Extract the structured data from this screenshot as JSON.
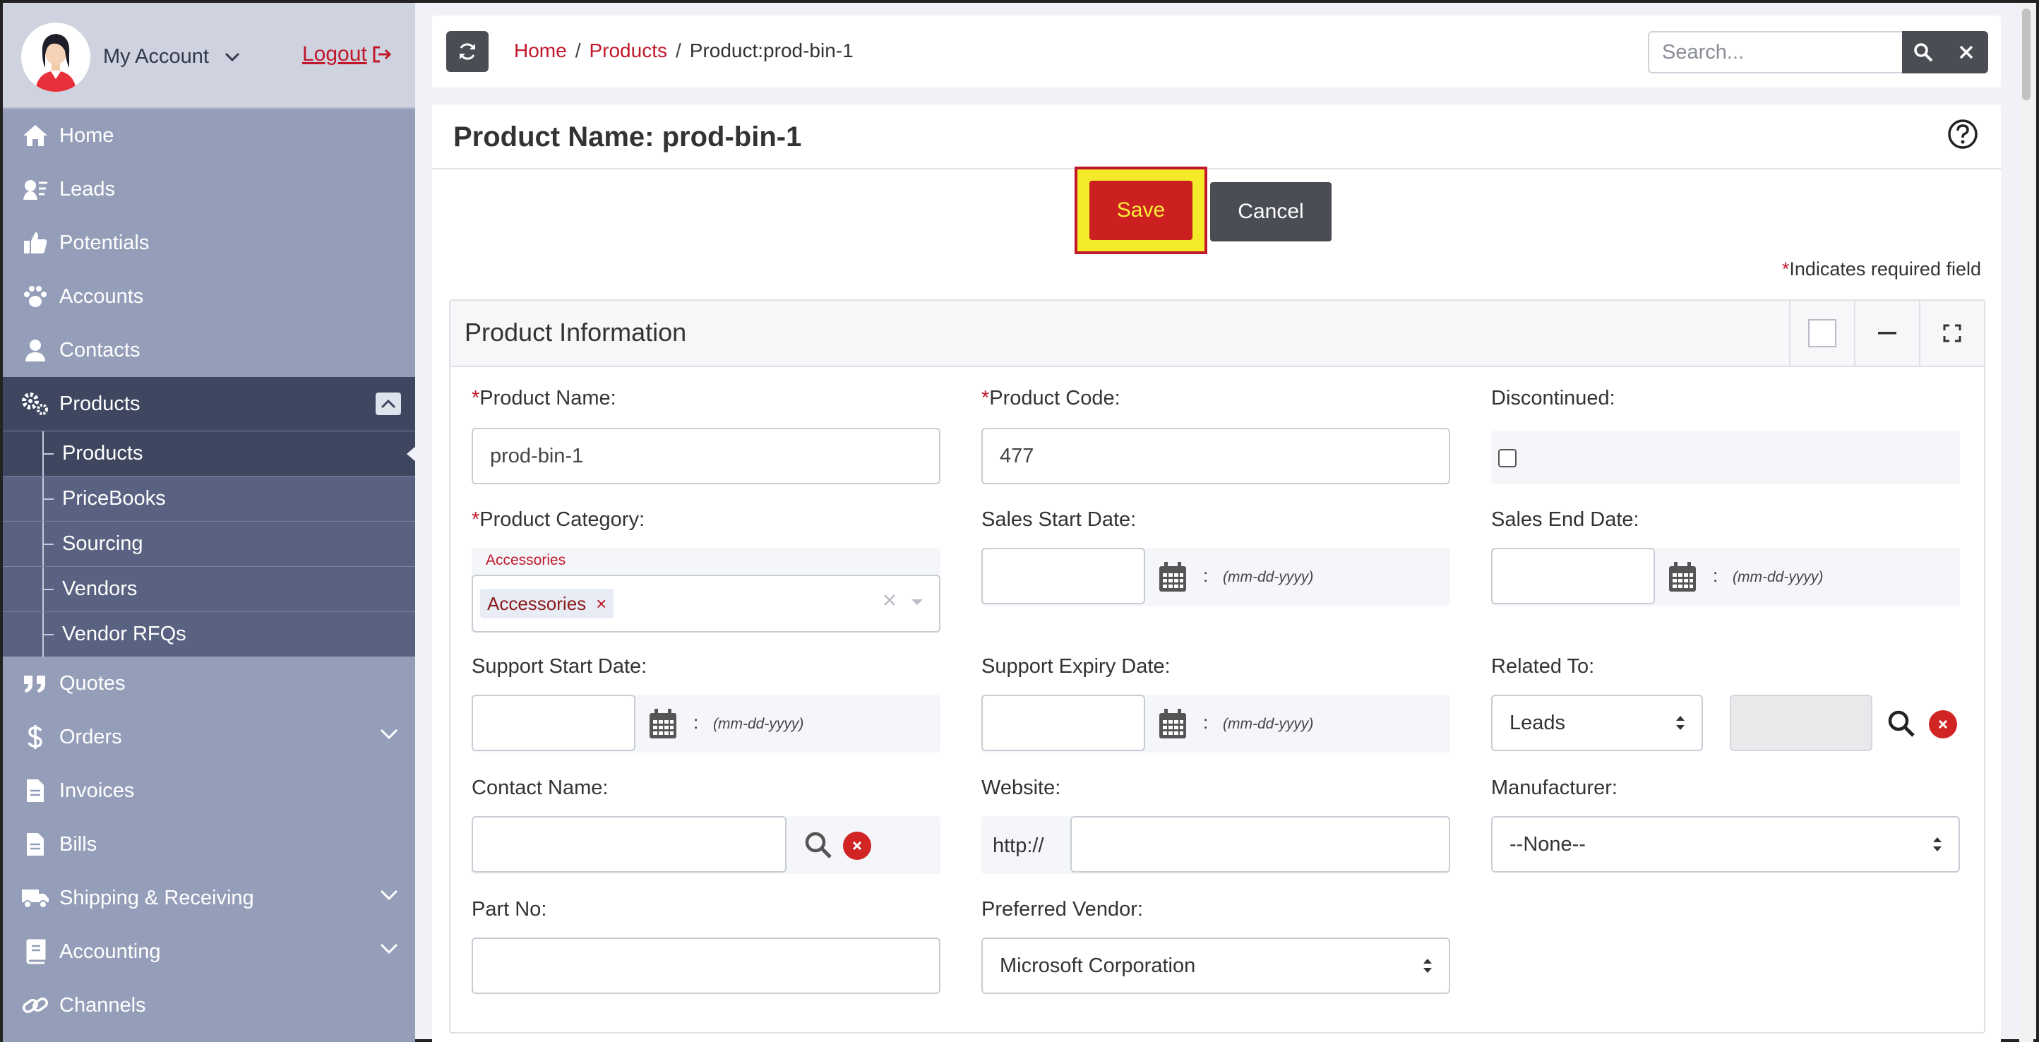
{
  "account": {
    "name": "My Account",
    "logout": "Logout"
  },
  "sidebar": {
    "items": [
      {
        "label": "Home",
        "icon": "home-icon"
      },
      {
        "label": "Leads",
        "icon": "leads-icon"
      },
      {
        "label": "Potentials",
        "icon": "thumbs-up-icon"
      },
      {
        "label": "Accounts",
        "icon": "paw-icon"
      },
      {
        "label": "Contacts",
        "icon": "user-icon"
      },
      {
        "label": "Products",
        "icon": "gears-icon"
      }
    ],
    "sub_items": [
      "Products",
      "PriceBooks",
      "Sourcing",
      "Vendors",
      "Vendor RFQs"
    ],
    "items_after": [
      {
        "label": "Quotes",
        "icon": "quote-icon"
      },
      {
        "label": "Orders",
        "icon": "dollar-icon"
      },
      {
        "label": "Invoices",
        "icon": "file-icon"
      },
      {
        "label": "Bills",
        "icon": "file-icon"
      },
      {
        "label": "Shipping & Receiving",
        "icon": "truck-icon"
      },
      {
        "label": "Accounting",
        "icon": "book-icon"
      },
      {
        "label": "Channels",
        "icon": "link-icon"
      }
    ]
  },
  "breadcrumb": {
    "home": "Home",
    "section": "Products",
    "sep": "/",
    "current": "Product:prod-bin-1"
  },
  "search": {
    "placeholder": "Search..."
  },
  "page": {
    "title": "Product Name: prod-bin-1",
    "save": "Save",
    "cancel": "Cancel",
    "required_star": "*",
    "required_note": "Indicates required field"
  },
  "section": {
    "title": "Product Information",
    "fields": {
      "product_name": {
        "label": "Product Name:",
        "value": "prod-bin-1"
      },
      "product_code": {
        "label": "Product Code:",
        "value": "477"
      },
      "discontinued": {
        "label": "Discontinued:"
      },
      "product_category": {
        "label": "Product Category:",
        "tag_label": "Accessories",
        "tag": "Accessories",
        "tag_remove": "×"
      },
      "sales_start": {
        "label": "Sales Start Date:"
      },
      "sales_end": {
        "label": "Sales End Date:"
      },
      "support_start": {
        "label": "Support Start Date:"
      },
      "support_expiry": {
        "label": "Support Expiry Date:"
      },
      "related_to": {
        "label": "Related To:",
        "value": "Leads"
      },
      "contact_name": {
        "label": "Contact Name:"
      },
      "website": {
        "label": "Website:",
        "prefix": "http://"
      },
      "manufacturer": {
        "label": "Manufacturer:",
        "value": "--None--"
      },
      "part_no": {
        "label": "Part No:"
      },
      "preferred_vendor": {
        "label": "Preferred Vendor:",
        "value": "Microsoft Corporation"
      }
    },
    "date_hint": "(mm-dd-yyyy)",
    "colon": ":"
  }
}
